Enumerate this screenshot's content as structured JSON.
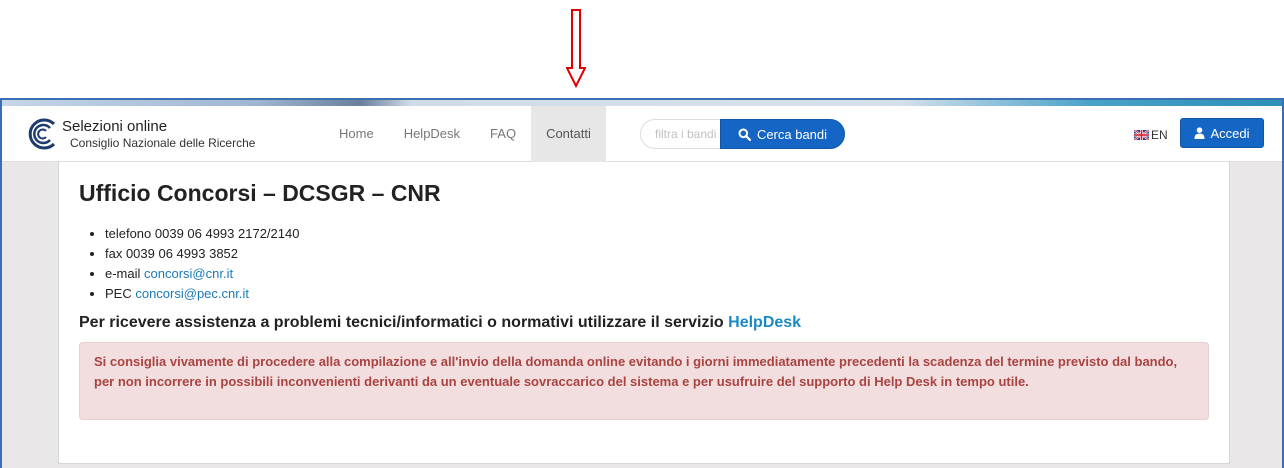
{
  "brand": {
    "title": "Selezioni online",
    "subtitle": "Consiglio Nazionale delle Ricerche"
  },
  "nav": {
    "items": [
      {
        "label": "Home",
        "active": false
      },
      {
        "label": "HelpDesk",
        "active": false
      },
      {
        "label": "FAQ",
        "active": false
      },
      {
        "label": "Contatti",
        "active": true
      }
    ]
  },
  "search": {
    "placeholder": "filtra i bandi",
    "button_label": "Cerca bandi",
    "icon": "search-icon"
  },
  "language": {
    "label": "EN",
    "icon": "uk-flag-icon"
  },
  "login": {
    "label": "Accedi",
    "icon": "user-icon"
  },
  "page": {
    "title": "Ufficio Concorsi – DCSGR – CNR",
    "contacts": [
      {
        "text": "telefono 0039 06 4993 2172/2140",
        "link": ""
      },
      {
        "text": "fax 0039 06 4993 3852",
        "link": ""
      },
      {
        "text": "e-mail ",
        "link": "concorsi@cnr.it"
      },
      {
        "text": "PEC ",
        "link": "concorsi@pec.cnr.it"
      }
    ],
    "assist_text": "Per ricevere assistenza a problemi tecnici/informatici o normativi utilizzare il servizio ",
    "assist_link": "HelpDesk",
    "alert": "Si consiglia vivamente di procedere alla compilazione e all'invio della domanda online evitando i giorni immediatamente precedenti la scadenza del termine previsto dal bando, per non incorrere in possibili inconvenienti derivanti da un eventuale sovraccarico del sistema e per usufruire del supporto di Help Desk in tempo utile."
  },
  "colors": {
    "primary": "#1566c4",
    "link": "#1a7ab8",
    "alert_bg": "#f2dede",
    "alert_text": "#a94442",
    "annotation_arrow": "#e00000"
  }
}
